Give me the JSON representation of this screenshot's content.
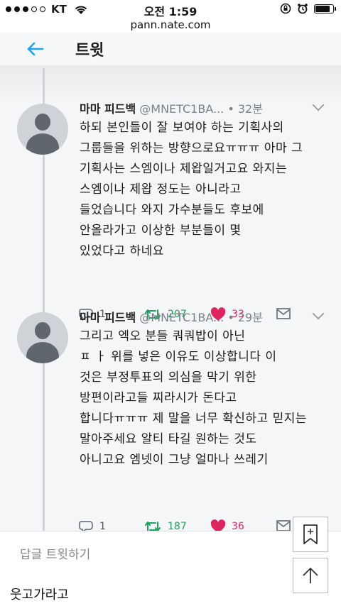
{
  "status": {
    "carrier": "KT",
    "time": "오전 1:59"
  },
  "browser": {
    "url": "pann.nate.com"
  },
  "twitter": {
    "header_title": "트윗",
    "reply_placeholder": "답글 트윗하기",
    "tweets": [
      {
        "name": "마마 피드백",
        "handle": "@MNETC1BA...",
        "time": "• 32분",
        "lines": [
          "하되 본인들이 잘 보여야 하는 기획사의",
          "그룹들을 위하는 방향으로요ㅠㅠㅠ 아마 그",
          "기획사는 스엠이나 제왑일거고요 와지는",
          "스엠이나 제왑 정도는 아니라고",
          "들었습니다 와지 가수분들도 후보에",
          "안올라가고 이상한 부분들이 몇",
          "있었다고 하네요"
        ],
        "replies": "1",
        "retweets": "207",
        "likes": "33"
      },
      {
        "name": "마마 피드백",
        "handle": "@MNETC1BA...",
        "time": "• 29분",
        "lines": [
          "그리고 엑오 분들 쿼쿼밥이 아닌",
          "ㅍ ㅏ 위를 넣은 이유도 이상합니다 이",
          "것은 부정투표의 의심을 막기 위한",
          "방편이라고들 찌라시가 돈다고",
          "합니다ㅠㅠㅠ 제 말을 너무 확신하고 믿지는",
          "말아주세요 알티 타길 원하는 것도",
          "아니고요 엠넷이 그냥 얼마나 쓰레기"
        ],
        "replies": "1",
        "retweets": "187",
        "likes": "36"
      }
    ]
  },
  "caption": "웃고가라고",
  "icons": [
    "wifi-icon",
    "battery-icon",
    "back-arrow-icon",
    "chevron-down-icon",
    "reply-icon",
    "retweet-icon",
    "heart-icon",
    "dm-icon",
    "bookmark-add-icon",
    "scroll-top-icon"
  ]
}
